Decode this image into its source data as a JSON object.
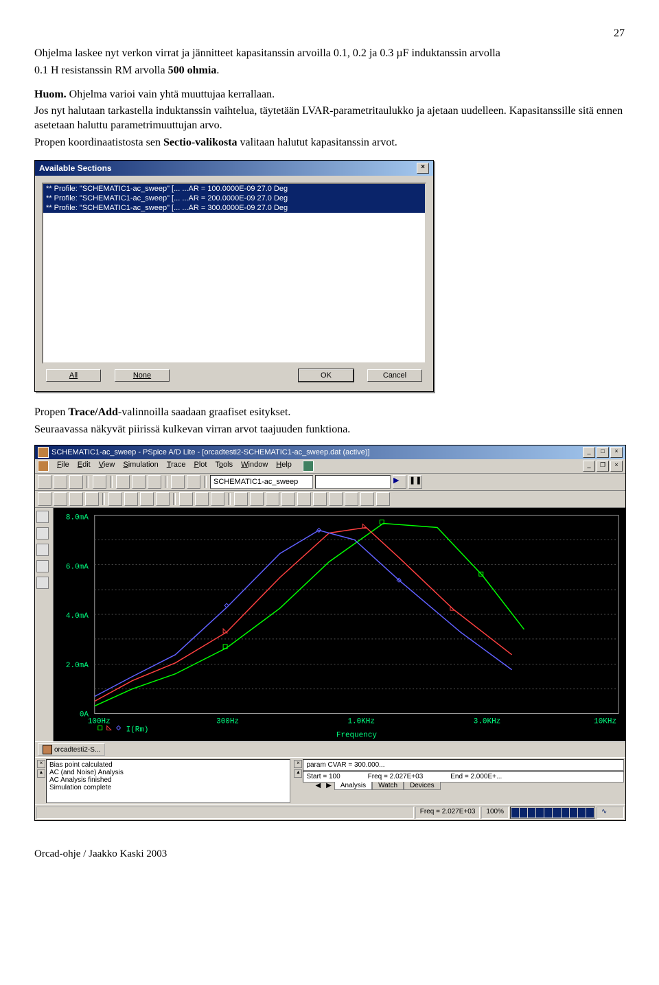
{
  "page_number": "27",
  "p1_a": "Ohjelma laskee nyt verkon virrat ja jännitteet kapasitanssin arvoilla 0.1, 0.2 ja 0.3 ",
  "p1_b": "µ",
  "p1_c": "F induktanssin arvolla",
  "p2_a": "0.1 H resistanssin RM arvolla  ",
  "p2_b": "500 ohmia",
  "p2_c": ".",
  "p3_a": "Huom.",
  "p3_b": " Ohjelma varioi vain yhtä muuttujaa kerrallaan.",
  "p4": "Jos nyt halutaan tarkastella induktanssin vaihtelua, täytetään LVAR-parametritaulukko ja ajetaan uudelleen. Kapasitanssille sitä ennen asetetaan haluttu parametrimuuttujan arvo.",
  "p5_a": "Propen koordinaatistosta  sen ",
  "p5_b": "Sectio-valikosta",
  "p5_c": " valitaan halutut kapasitanssin arvot.",
  "dialog": {
    "title": "Available Sections",
    "rows": [
      "** Profile: \"SCHEMATIC1-ac_sweep\"  [... ...AR = 100.0000E-09   27.0 Deg",
      "** Profile: \"SCHEMATIC1-ac_sweep\"  [... ...AR = 200.0000E-09   27.0 Deg",
      "** Profile: \"SCHEMATIC1-ac_sweep\"  [... ...AR = 300.0000E-09   27.0 Deg"
    ],
    "btn_all": "All",
    "btn_none": "None",
    "btn_ok": "OK",
    "btn_cancel": "Cancel"
  },
  "p6_a": "Propen ",
  "p6_b": "Trace/Add",
  "p6_c": "-valinnoilla saadaan graafiset esitykset.",
  "p7": "Seuraavassa näkyvät piirissä kulkevan virran arvot taajuuden funktiona.",
  "app": {
    "title": "SCHEMATIC1-ac_sweep - PSpice A/D Lite  - [orcadtesti2-SCHEMATIC1-ac_sweep.dat (active)]",
    "menus": [
      "File",
      "Edit",
      "View",
      "Simulation",
      "Trace",
      "Plot",
      "Tools",
      "Window",
      "Help"
    ],
    "combo": "SCHEMATIC1-ac_sweep",
    "y_ticks": [
      "8.0mA",
      "6.0mA",
      "4.0mA",
      "2.0mA",
      "0A"
    ],
    "x_ticks": [
      "100Hz",
      "300Hz",
      "1.0KHz",
      "3.0KHz",
      "10KHz"
    ],
    "xlabel": "Frequency",
    "trace_label": "I(Rm)",
    "doc_btn": "orcadtesti2-S...",
    "log_lines": [
      "Bias point calculated",
      "AC (and Noise) Analysis",
      "AC Analysis finished",
      "Simulation complete"
    ],
    "param_line": "param CVAR =  300.000...",
    "summary_line_a": "Start = 100",
    "summary_line_b": "Freq =  2.027E+03",
    "summary_line_c": "End =  2.000E+...",
    "tabs": [
      "Analysis",
      "Watch",
      "Devices"
    ],
    "status_freq": "Freq =  2.027E+03",
    "status_pct": "100%"
  },
  "footer": "Orcad-ohje / Jaakko Kaski 2003",
  "chart_data": {
    "type": "line",
    "xlabel": "Frequency",
    "ylabel": "I(Rm)",
    "x_scale": "log",
    "xlim": [
      100,
      10000
    ],
    "ylim": [
      0,
      0.008
    ],
    "x_ticks": [
      100,
      300,
      1000,
      3000,
      10000
    ],
    "y_ticks": [
      0,
      0.002,
      0.004,
      0.006,
      0.008
    ],
    "series": [
      {
        "name": "CVAR=100n",
        "color": "#00ff00",
        "x": [
          100,
          200,
          300,
          500,
          800,
          1200,
          1800,
          2500,
          3200,
          4000
        ],
        "y": [
          0.0003,
          0.0007,
          0.0012,
          0.0022,
          0.0038,
          0.006,
          0.0078,
          0.0076,
          0.0056,
          0.0034
        ]
      },
      {
        "name": "CVAR=200n",
        "color": "#ff4040",
        "x": [
          100,
          200,
          300,
          500,
          800,
          1200,
          1600,
          2000,
          2600,
          3400
        ],
        "y": [
          0.0005,
          0.0011,
          0.0018,
          0.0033,
          0.0055,
          0.0073,
          0.0075,
          0.0063,
          0.0042,
          0.0024
        ]
      },
      {
        "name": "CVAR=300n",
        "color": "#6060ff",
        "x": [
          100,
          200,
          300,
          500,
          800,
          1100,
          1400,
          1800,
          2400,
          3200
        ],
        "y": [
          0.0007,
          0.0015,
          0.0024,
          0.0043,
          0.0065,
          0.0074,
          0.007,
          0.0054,
          0.0033,
          0.0018
        ]
      }
    ]
  }
}
